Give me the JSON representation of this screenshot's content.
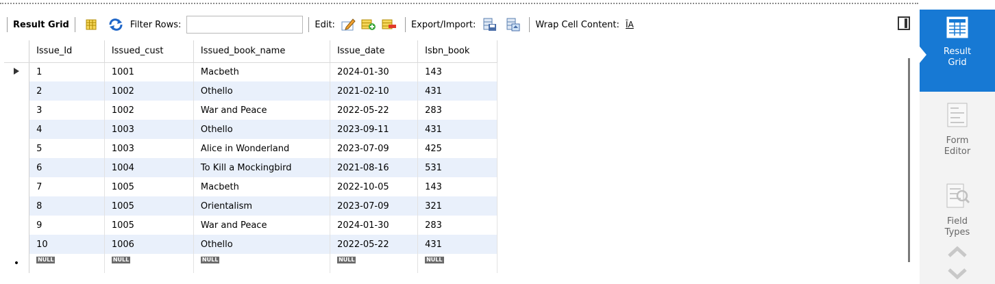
{
  "toolbar": {
    "result_grid": "Result Grid",
    "filter_rows": "Filter Rows:",
    "filter_value": "",
    "edit": "Edit:",
    "export_import": "Export/Import:",
    "wrap_cell": "Wrap Cell Content:",
    "wrap_icon_glyph": "ĪA"
  },
  "grid": {
    "columns": [
      "Issue_Id",
      "Issued_cust",
      "Issued_book_name",
      "Issue_date",
      "Isbn_book"
    ],
    "rows": [
      [
        "1",
        "1001",
        "Macbeth",
        "2024-01-30",
        "143"
      ],
      [
        "2",
        "1002",
        "Othello",
        "2021-02-10",
        "431"
      ],
      [
        "3",
        "1002",
        "War and Peace",
        "2022-05-22",
        "283"
      ],
      [
        "4",
        "1003",
        "Othello",
        "2023-09-11",
        "431"
      ],
      [
        "5",
        "1003",
        "Alice in Wonderland",
        "2023-07-09",
        "425"
      ],
      [
        "6",
        "1004",
        "To Kill a Mockingbird",
        "2021-08-16",
        "531"
      ],
      [
        "7",
        "1005",
        "Macbeth",
        "2022-10-05",
        "143"
      ],
      [
        "8",
        "1005",
        "Orientalism",
        "2023-07-09",
        "321"
      ],
      [
        "9",
        "1005",
        "War and Peace",
        "2024-01-30",
        "283"
      ],
      [
        "10",
        "1006",
        "Othello",
        "2022-05-22",
        "431"
      ]
    ],
    "null_label": "NULL"
  },
  "sidebar": {
    "result_grid": "Result Grid",
    "form_editor": "Form Editor",
    "field_types": "Field Types"
  },
  "colors": {
    "accent": "#1779d4",
    "row_alt": "#e9f0fb"
  },
  "icons": {
    "toolbar": [
      "grid-columns-icon",
      "refresh-icon",
      "edit-pencil-icon",
      "add-row-icon",
      "delete-row-icon",
      "export-icon",
      "import-icon",
      "wrap-text-icon",
      "panel-toggle-icon"
    ],
    "sidebar": [
      "result-grid-icon",
      "form-editor-icon",
      "field-types-icon",
      "scroll-up-icon",
      "scroll-down-icon"
    ]
  }
}
